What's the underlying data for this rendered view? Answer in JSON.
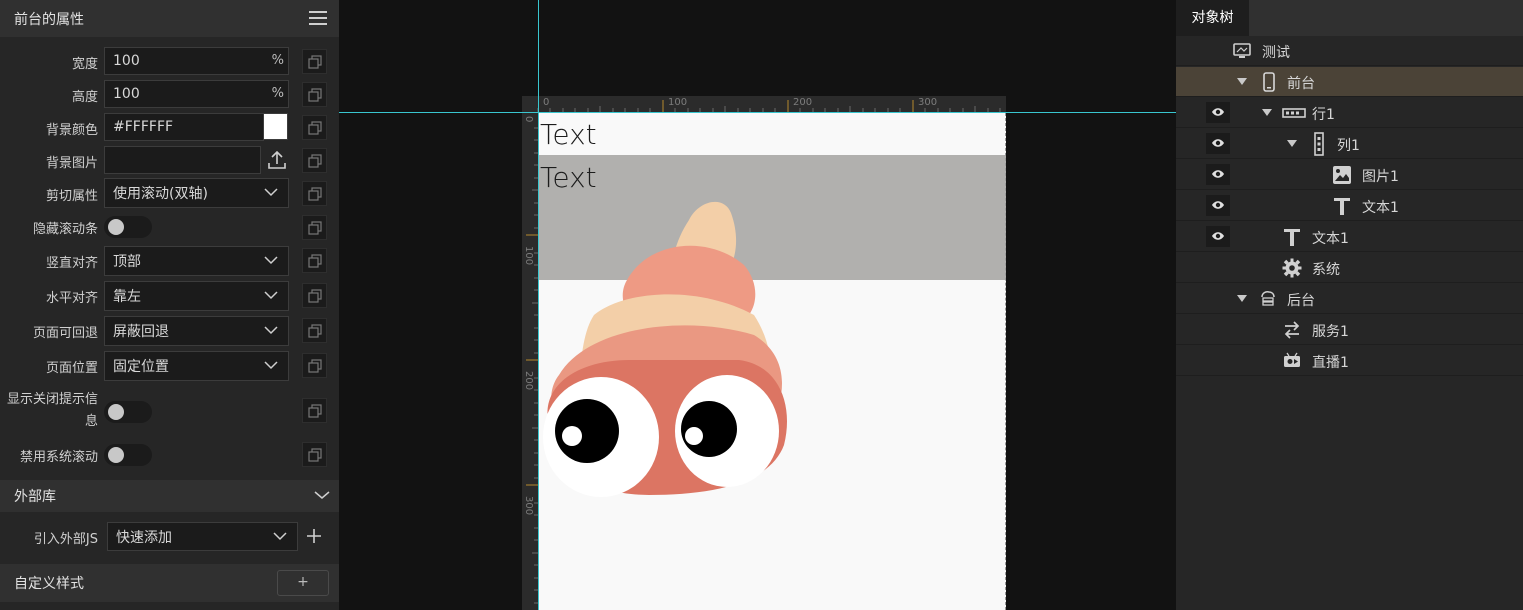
{
  "left_panel": {
    "title": "前台的属性",
    "props": {
      "width_label": "宽度",
      "width_value": "100",
      "width_unit": "%",
      "height_label": "高度",
      "height_value": "100",
      "height_unit": "%",
      "bgcolor_label": "背景颜色",
      "bgcolor_value": "#FFFFFF",
      "bgcolor_swatch": "#FFFFFF",
      "bgimage_label": "背景图片",
      "bgimage_value": "",
      "clip_label": "剪切属性",
      "clip_value": "使用滚动(双轴)",
      "hide_scroll_label": "隐藏滚动条",
      "valign_label": "竖直对齐",
      "valign_value": "顶部",
      "halign_label": "水平对齐",
      "halign_value": "靠左",
      "back_label": "页面可回退",
      "back_value": "屏蔽回退",
      "position_label": "页面位置",
      "position_value": "固定位置",
      "close_tip_label": "显示关闭提示信息",
      "disable_scroll_label": "禁用系统滚动"
    },
    "external_lib": {
      "title": "外部库",
      "import_label": "引入外部JS",
      "import_value": "快速添加"
    },
    "custom_style": {
      "title": "自定义样式",
      "add_label": "+"
    }
  },
  "canvas": {
    "ruler_top": [
      "0",
      "100",
      "200",
      "300"
    ],
    "ruler_left": [
      "0",
      "100",
      "200",
      "300"
    ],
    "text_1": "Text",
    "text_2": "Text",
    "grey_row_color": "#B1B0AE"
  },
  "object_tree": {
    "tab": "对象树",
    "nodes": [
      {
        "label": "测试",
        "icon": "monitor-icon"
      },
      {
        "label": "前台",
        "icon": "phone-icon",
        "selected": true
      },
      {
        "label": "行1",
        "icon": "row-icon"
      },
      {
        "label": "列1",
        "icon": "column-icon"
      },
      {
        "label": "图片1",
        "icon": "image-icon"
      },
      {
        "label": "文本1",
        "icon": "text-icon"
      },
      {
        "label": "文本1",
        "icon": "text-icon"
      },
      {
        "label": "系统",
        "icon": "gear-icon"
      },
      {
        "label": "后台",
        "icon": "server-icon"
      },
      {
        "label": "服务1",
        "icon": "exchange-icon"
      },
      {
        "label": "直播1",
        "icon": "live-icon"
      }
    ]
  }
}
